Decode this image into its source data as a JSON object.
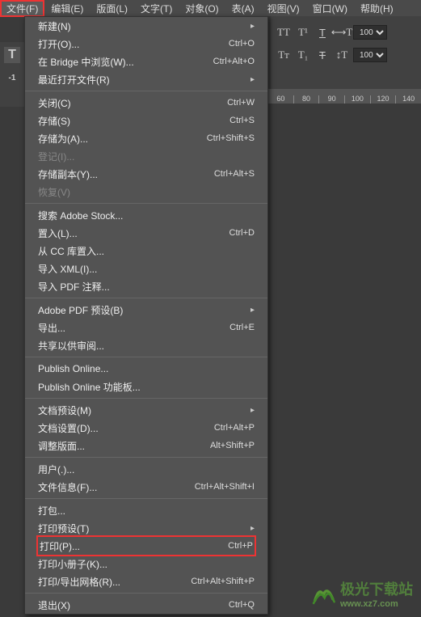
{
  "menubar": {
    "items": [
      "文件(F)",
      "编辑(E)",
      "版面(L)",
      "文字(T)",
      "对象(O)",
      "表(A)",
      "视图(V)",
      "窗口(W)",
      "帮助(H)"
    ]
  },
  "sidebar": {
    "neg1": "-1"
  },
  "right_panel": {
    "pct1": "100%",
    "pct2": "100%"
  },
  "ruler": {
    "marks": [
      "60",
      "80",
      "90",
      "100",
      "120",
      "140"
    ]
  },
  "menu": {
    "new": "新建(N)",
    "open": "打开(O)...",
    "open_sc": "Ctrl+O",
    "browse": "在 Bridge 中浏览(W)...",
    "browse_sc": "Ctrl+Alt+O",
    "recent": "最近打开文件(R)",
    "close": "关闭(C)",
    "close_sc": "Ctrl+W",
    "save": "存储(S)",
    "save_sc": "Ctrl+S",
    "saveas": "存储为(A)...",
    "saveas_sc": "Ctrl+Shift+S",
    "checkin": "登记(I)...",
    "savecopy": "存储副本(Y)...",
    "savecopy_sc": "Ctrl+Alt+S",
    "revert": "恢复(V)",
    "adobestock": "搜索 Adobe Stock...",
    "place": "置入(L)...",
    "place_sc": "Ctrl+D",
    "placecc": "从 CC 库置入...",
    "importxml": "导入 XML(I)...",
    "importpdf": "导入 PDF 注释...",
    "pdfpreset": "Adobe PDF 预设(B)",
    "export": "导出...",
    "export_sc": "Ctrl+E",
    "share": "共享以供审阅...",
    "pubonline": "Publish Online...",
    "pubpanel": "Publish Online 功能板...",
    "docpreset": "文档预设(M)",
    "docsetup": "文档设置(D)...",
    "docsetup_sc": "Ctrl+Alt+P",
    "adjustlayout": "调整版面...",
    "adjustlayout_sc": "Alt+Shift+P",
    "user": "用户(.)...",
    "fileinfo": "文件信息(F)...",
    "fileinfo_sc": "Ctrl+Alt+Shift+I",
    "package": "打包...",
    "printpreset": "打印预设(T)",
    "print": "打印(P)...",
    "print_sc": "Ctrl+P",
    "printbooklet": "打印小册子(K)...",
    "printexportgrid": "打印/导出网格(R)...",
    "printexportgrid_sc": "Ctrl+Alt+Shift+P",
    "exit": "退出(X)",
    "exit_sc": "Ctrl+Q"
  },
  "watermark": {
    "title": "极光下载站",
    "sub": "www.xz7.com"
  }
}
